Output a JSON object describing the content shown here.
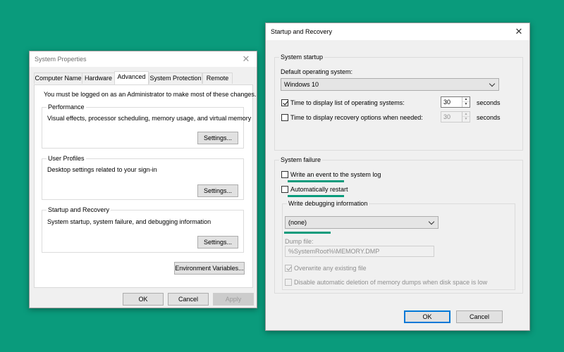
{
  "colors": {
    "background": "#0a9b7c",
    "highlight": "#0a9b7c",
    "default_button_border": "#0078d7"
  },
  "system_properties": {
    "title": "System Properties",
    "close_glyph": "✕",
    "tabs": [
      {
        "label": "Computer Name",
        "active": false
      },
      {
        "label": "Hardware",
        "active": false
      },
      {
        "label": "Advanced",
        "active": true
      },
      {
        "label": "System Protection",
        "active": false
      },
      {
        "label": "Remote",
        "active": false
      }
    ],
    "admin_note": "You must be logged on as an Administrator to make most of these changes.",
    "performance": {
      "legend": "Performance",
      "description": "Visual effects, processor scheduling, memory usage, and virtual memory",
      "button": "Settings..."
    },
    "user_profiles": {
      "legend": "User Profiles",
      "description": "Desktop settings related to your sign-in",
      "button": "Settings..."
    },
    "startup_recovery": {
      "legend": "Startup and Recovery",
      "description": "System startup, system failure, and debugging information",
      "button": "Settings..."
    },
    "env_button": "Environment Variables...",
    "ok": "OK",
    "cancel": "Cancel",
    "apply": "Apply"
  },
  "startup_dialog": {
    "title": "Startup and Recovery",
    "close_glyph": "✕",
    "system_startup": {
      "legend": "System startup",
      "default_os_label": "Default operating system:",
      "default_os_value": "Windows 10",
      "time_display_list": {
        "label": "Time to display list of operating systems:",
        "checked": true,
        "value": "30",
        "unit": "seconds"
      },
      "time_display_recovery": {
        "label": "Time to display recovery options when needed:",
        "checked": false,
        "value": "30",
        "unit": "seconds"
      }
    },
    "system_failure": {
      "legend": "System failure",
      "write_event": {
        "label": "Write an event to the system log",
        "checked": false
      },
      "auto_restart": {
        "label": "Automatically restart",
        "checked": false
      },
      "debug_info": {
        "legend": "Write debugging information",
        "selected": "(none)",
        "dump_file_label": "Dump file:",
        "dump_file_value": "%SystemRoot%\\MEMORY.DMP",
        "overwrite": {
          "label": "Overwrite any existing file",
          "checked": true,
          "enabled": false
        },
        "disable_auto_delete": {
          "label": "Disable automatic deletion of memory dumps when disk space is low",
          "checked": false,
          "enabled": false
        }
      }
    },
    "ok": "OK",
    "cancel": "Cancel"
  }
}
